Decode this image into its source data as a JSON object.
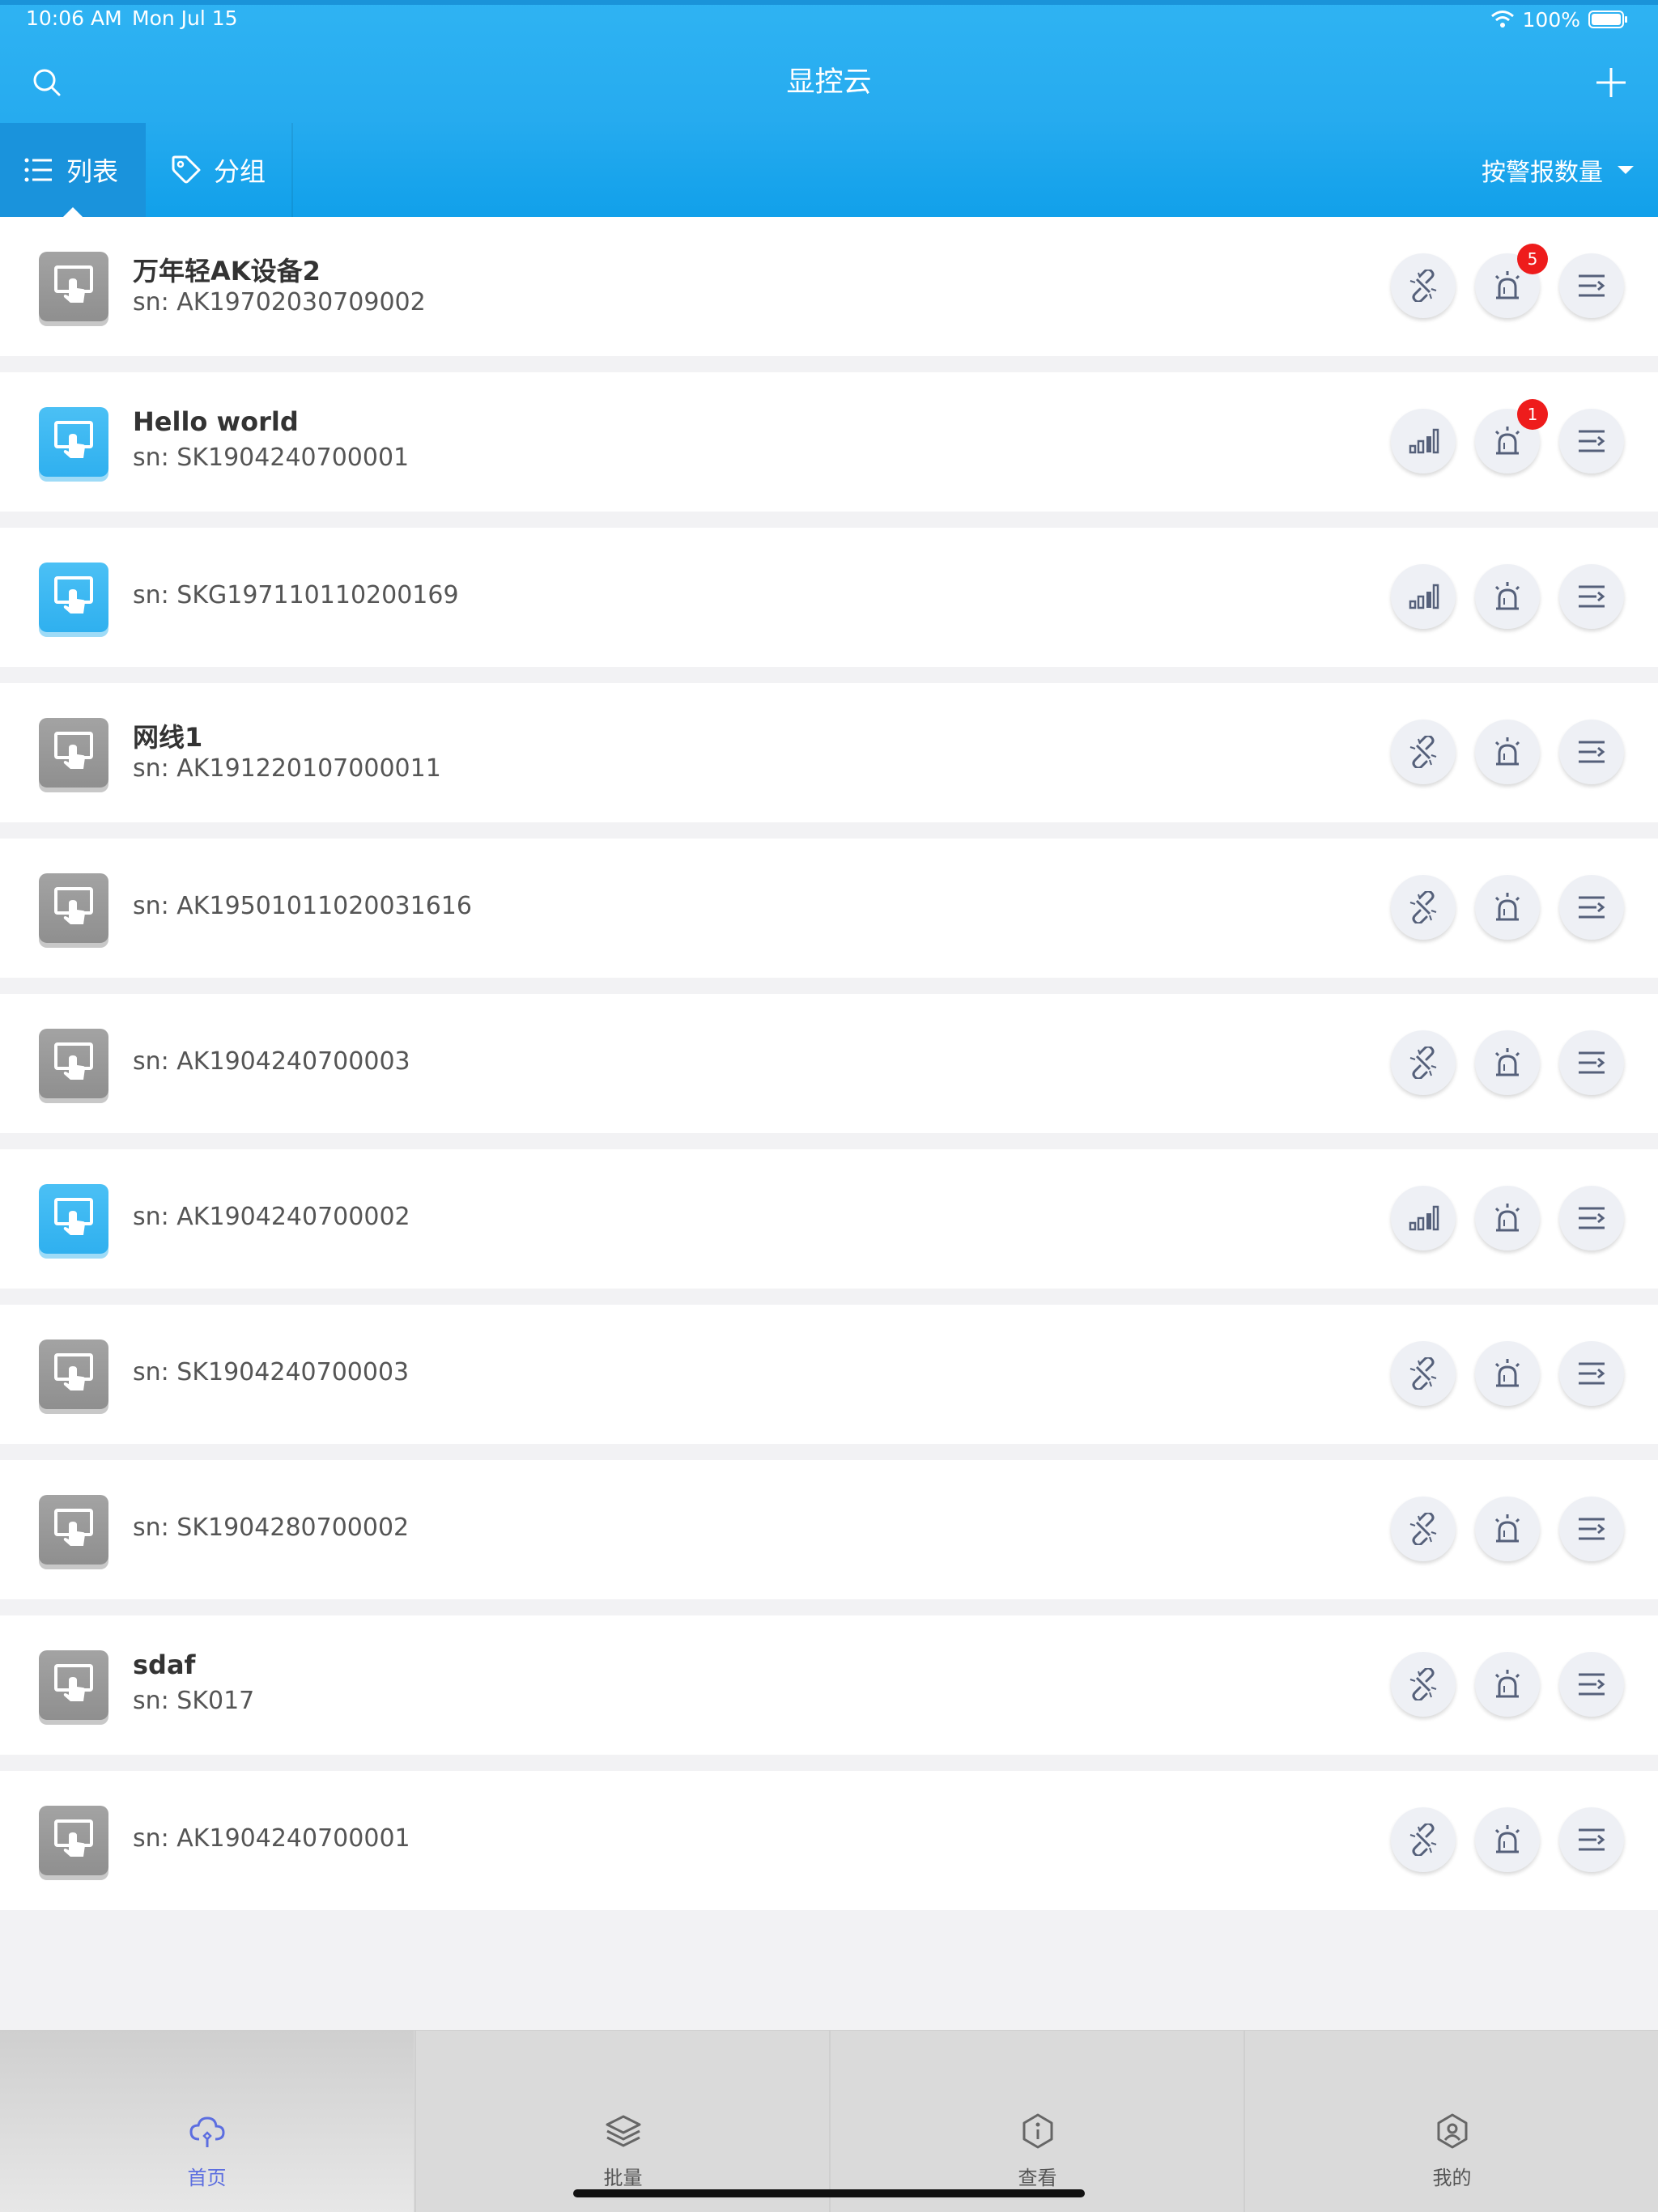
{
  "status_bar": {
    "time": "10:06 AM",
    "date": "Mon Jul 15",
    "battery": "100%"
  },
  "app": {
    "title": "显控云"
  },
  "tabs": {
    "list_label": "列表",
    "group_label": "分组"
  },
  "sort": {
    "label": "按警报数量"
  },
  "devices": [
    {
      "name": "万年轻AK设备2",
      "sn": "sn: AK19702030709002",
      "online": false,
      "alarms": "5"
    },
    {
      "name": "Hello world",
      "sn": "sn: SK1904240700001",
      "online": true,
      "alarms": "1"
    },
    {
      "name": "",
      "sn": "sn: SKG197110110200169",
      "online": true,
      "alarms": ""
    },
    {
      "name": "网线1",
      "sn": "sn: AK191220107000011",
      "online": false,
      "alarms": ""
    },
    {
      "name": "",
      "sn": "sn: AK19501011020031616",
      "online": false,
      "alarms": ""
    },
    {
      "name": "",
      "sn": "sn: AK1904240700003",
      "online": false,
      "alarms": ""
    },
    {
      "name": "",
      "sn": "sn: AK1904240700002",
      "online": true,
      "alarms": ""
    },
    {
      "name": "",
      "sn": "sn: SK1904240700003",
      "online": false,
      "alarms": ""
    },
    {
      "name": "",
      "sn": "sn: SK1904280700002",
      "online": false,
      "alarms": ""
    },
    {
      "name": "sdaf",
      "sn": "sn: SK017",
      "online": false,
      "alarms": ""
    },
    {
      "name": "",
      "sn": "sn: AK1904240700001",
      "online": false,
      "alarms": ""
    }
  ],
  "tabbar": [
    {
      "label": "首页",
      "icon": "cloud-icon",
      "active": true
    },
    {
      "label": "批量",
      "icon": "layers-icon",
      "active": false
    },
    {
      "label": "查看",
      "icon": "info-shield-icon",
      "active": false
    },
    {
      "label": "我的",
      "icon": "profile-shield-icon",
      "active": false
    }
  ],
  "colors": {
    "header": "#26abef",
    "online": "#2fb0ef",
    "offline": "#9a9a9a",
    "badge": "#ee1c1c",
    "active_tab": "#5c6ee0"
  }
}
